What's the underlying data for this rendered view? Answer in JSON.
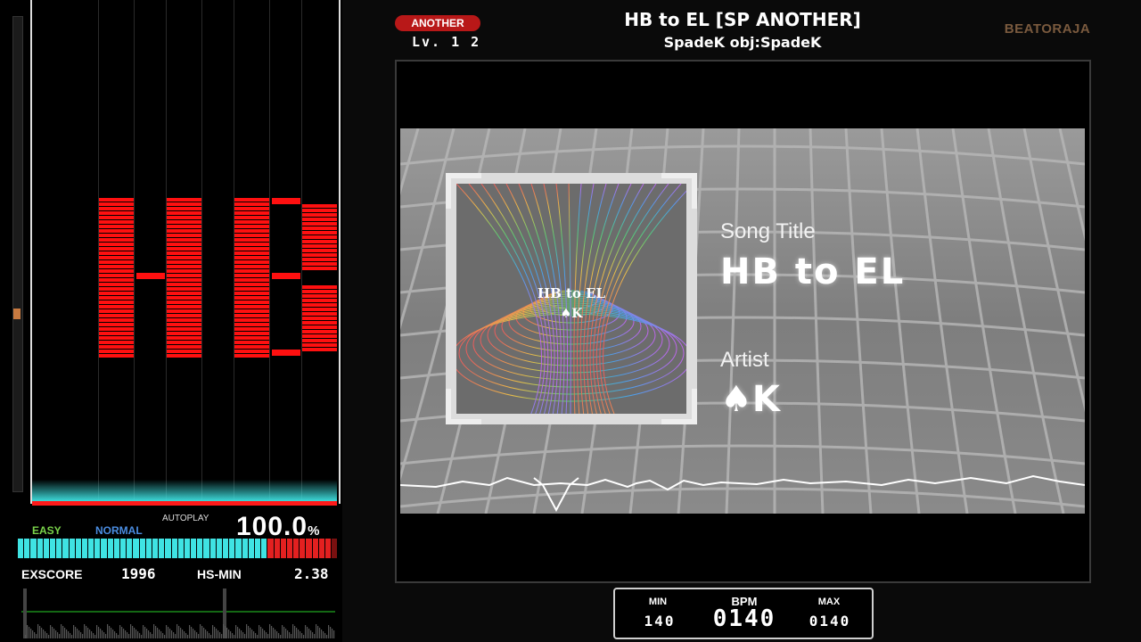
{
  "header": {
    "difficulty_badge": "ANOTHER",
    "level": "Lv. 1 2",
    "song_title_full": "HB to EL [SP ANOTHER]",
    "artist_line": "SpadeK obj:SpadeK",
    "brand": "BEATORAJA"
  },
  "gauge": {
    "label_easy": "EASY",
    "label_normal": "NORMAL",
    "mode": "AUTOPLAY",
    "percent": "100.0",
    "percent_unit": "%",
    "value_fraction": 1.0,
    "colors": {
      "cyan": "#3fe3e3",
      "red": "#e32020"
    }
  },
  "stats": {
    "exscore_label": "EXSCORE",
    "exscore_value": "1996",
    "hs_label": "HS-MIN",
    "hs_value": "2.38"
  },
  "song_info": {
    "song_title_label": "Song Title",
    "song_title": "HB to EL",
    "artist_label": "Artist",
    "artist_glyph": "♠",
    "artist_letter": "K"
  },
  "jacket": {
    "title": "HB to EL",
    "artist": "♠K"
  },
  "bpm": {
    "min_label": "MIN",
    "bpm_label": "BPM",
    "max_label": "MAX",
    "min_value": "140",
    "current_value": "0140",
    "max_value": "0140"
  },
  "colors": {
    "note": "#ff1010",
    "badge": "#b81818",
    "brand": "#7a5a3e"
  }
}
